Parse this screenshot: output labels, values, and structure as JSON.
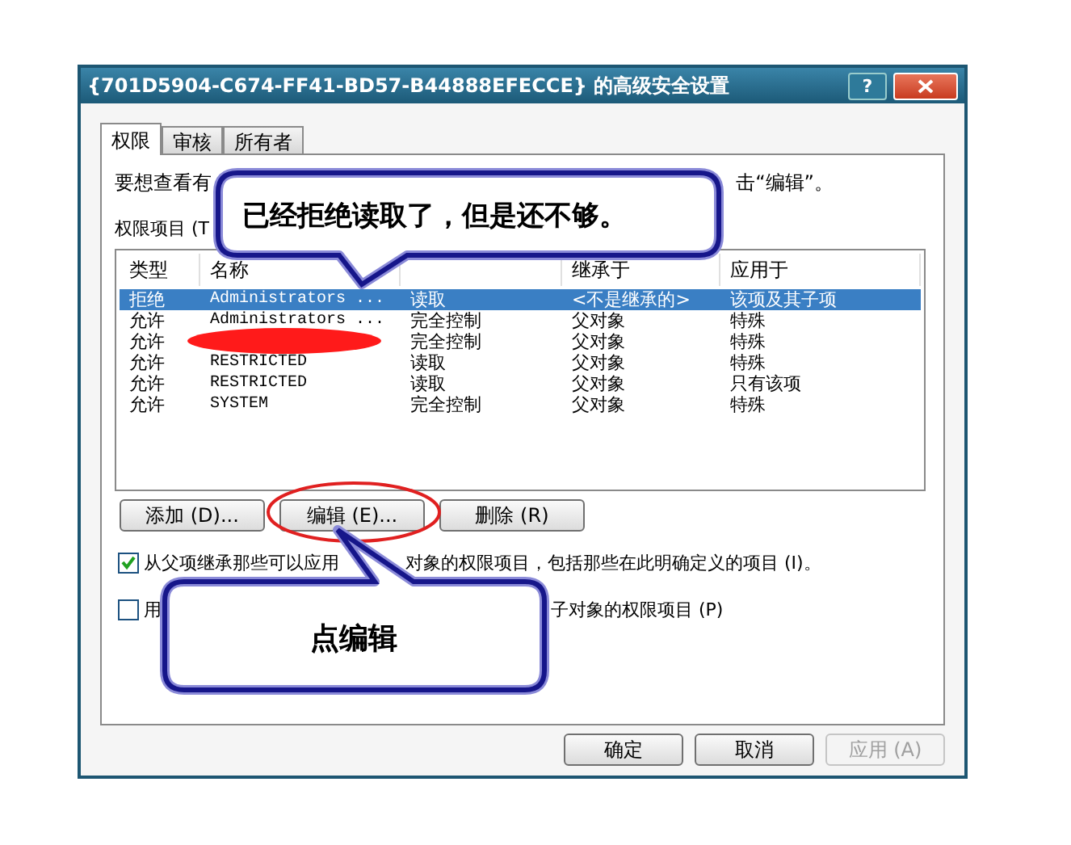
{
  "window": {
    "title": "{701D5904-C674-FF41-BD57-B44888EFECCE} 的高级安全设置",
    "help": "?"
  },
  "tabs": [
    {
      "label": "权限",
      "selected": true
    },
    {
      "label": "审核",
      "selected": false
    },
    {
      "label": "所有者",
      "selected": false
    }
  ],
  "intro_text": [
    "要想查看有",
    "击“编辑”。"
  ],
  "list_label": "权限项目 (T",
  "columns": [
    "类型",
    "名称",
    "继承于",
    "应用于"
  ],
  "rows": [
    {
      "type": "拒绝",
      "name": "Administrators ...",
      "permission": "读取",
      "inherited_from": "<不是继承的>",
      "applies_to": "该项及其子项",
      "selected": true
    },
    {
      "type": "允许",
      "name": "Administrators ...",
      "permission": "完全控制",
      "inherited_from": "父对象",
      "applies_to": "特殊",
      "selected": false
    },
    {
      "type": "允许",
      "redacted": true,
      "permission": "完全控制",
      "inherited_from": "父对象",
      "applies_to": "特殊",
      "selected": false
    },
    {
      "type": "允许",
      "name": "RESTRICTED",
      "permission": "读取",
      "inherited_from": "父对象",
      "applies_to": "特殊",
      "selected": false
    },
    {
      "type": "允许",
      "name": "RESTRICTED",
      "permission": "读取",
      "inherited_from": "父对象",
      "applies_to": "只有该项",
      "selected": false
    },
    {
      "type": "允许",
      "name": "SYSTEM",
      "permission": "完全控制",
      "inherited_from": "父对象",
      "applies_to": "特殊",
      "selected": false
    }
  ],
  "list_buttons": [
    "添加 (D)...",
    "编辑 (E)...",
    "删除 (R)"
  ],
  "checkboxes": [
    {
      "label": [
        "从父项继承那些可以应用",
        "对象的权限项目，包括那些在此明确定义的项目 (I)。"
      ],
      "checked": true
    },
    {
      "label": [
        "用",
        "子对象的权限项目 (P)"
      ],
      "checked": false
    }
  ],
  "dialog_buttons": [
    {
      "label": "确定",
      "disabled": false
    },
    {
      "label": "取消",
      "disabled": false
    },
    {
      "label": "应用 (A)",
      "disabled": true
    }
  ],
  "callouts": [
    "已经拒绝读取了，但是还不够。",
    "点编辑"
  ]
}
